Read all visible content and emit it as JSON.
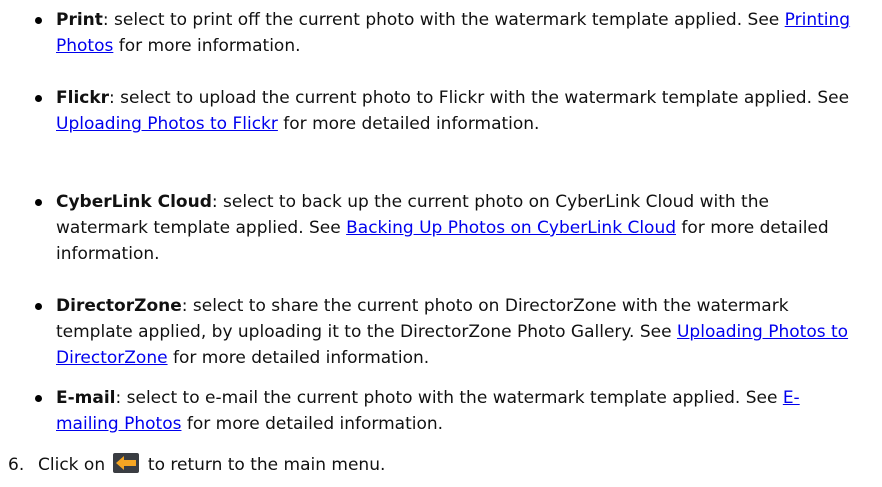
{
  "bullets": [
    {
      "title": "Print",
      "text_before": ": select to print off the current photo with the watermark template applied. See ",
      "link": "Printing Photos",
      "text_after": " for more information."
    },
    {
      "title": "Flickr",
      "text_before": ": select to upload the current photo to Flickr with the watermark template applied. See ",
      "link": "Uploading Photos to Flickr",
      "text_after": " for more detailed information."
    },
    {
      "title": "CyberLink Cloud",
      "text_before": ": select to back up the current photo on CyberLink Cloud with the watermark template applied. See ",
      "link": "Backing Up Photos on CyberLink Cloud",
      "text_after": " for more detailed information."
    },
    {
      "title": "DirectorZone",
      "text_before": ": select to share the current photo on DirectorZone with the watermark template applied, by uploading it to the  DirectorZone Photo Gallery. See ",
      "link": "Uploading Photos to DirectorZone",
      "text_after": " for more detailed information."
    },
    {
      "title": "E-mail",
      "text_before": ": select to e-mail the current photo with the watermark template applied. See ",
      "link": "E-mailing Photos",
      "text_after": " for more detailed information."
    }
  ],
  "step": {
    "number": "6.",
    "text_before": "Click on",
    "icon": "back-arrow-icon",
    "text_after": "to return to the main menu."
  },
  "colors": {
    "link": "#0000ee",
    "icon_arrow": "#f6a623",
    "icon_bg": "#3a3d42"
  }
}
